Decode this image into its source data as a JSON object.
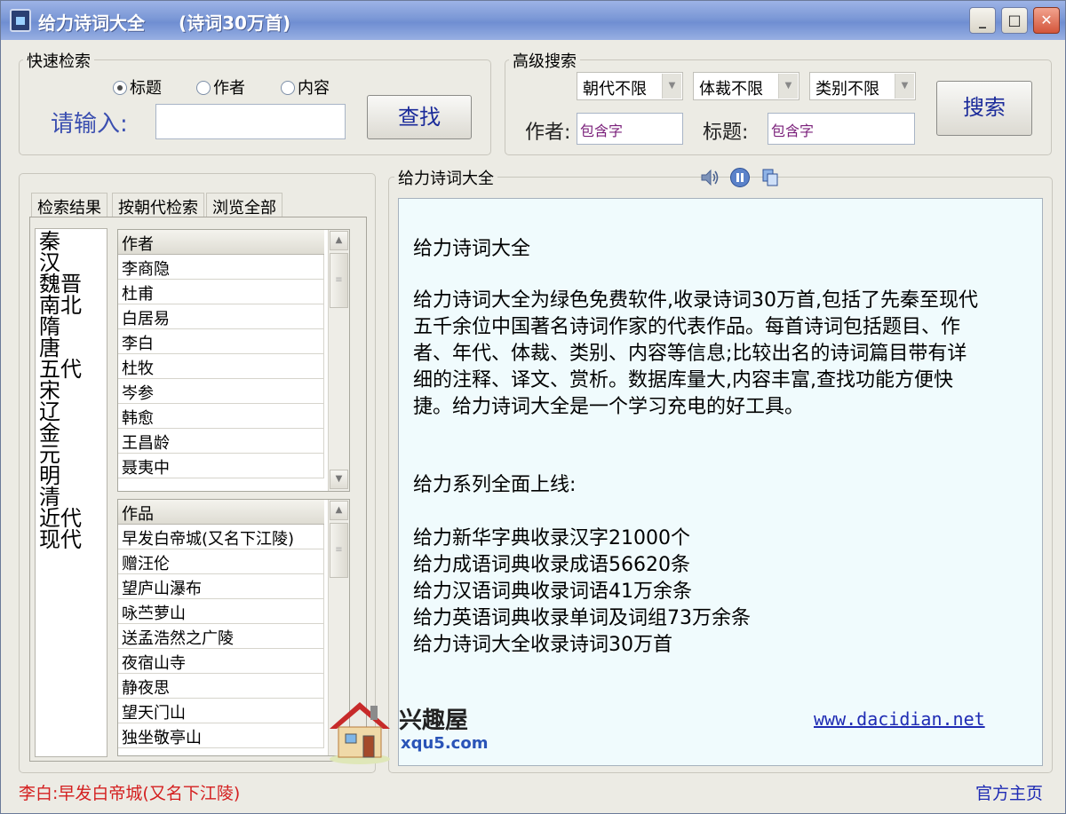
{
  "window": {
    "title": "给力诗词大全",
    "subtitle": "(诗词30万首)",
    "minimize_glyph": "_",
    "maximize_glyph": "□",
    "close_glyph": "✕"
  },
  "quick_search": {
    "group_title": "快速检索",
    "radios": [
      {
        "label": "标题",
        "checked": true
      },
      {
        "label": "作者",
        "checked": false
      },
      {
        "label": "内容",
        "checked": false
      }
    ],
    "input_label": "请输入:",
    "input_value": "",
    "button_label": "查找"
  },
  "advanced_search": {
    "group_title": "高级搜索",
    "dynasty_select": "朝代不限",
    "genre_select": "体裁不限",
    "category_select": "类别不限",
    "author_label": "作者:",
    "author_value": "包含字",
    "title_label": "标题:",
    "title_value": "包含字",
    "button_label": "搜索"
  },
  "left_panel": {
    "tabs": [
      "检索结果",
      "按朝代检索",
      "浏览全部"
    ],
    "dynasties": [
      "秦",
      "汉",
      "魏晋",
      "南北",
      "隋",
      "唐",
      "五代",
      "宋",
      "辽",
      "金",
      "元",
      "明",
      "清",
      "近代",
      "现代"
    ],
    "authors_header": "作者",
    "authors": [
      "李商隐",
      "杜甫",
      "白居易",
      "李白",
      "杜牧",
      "岑参",
      "韩愈",
      "王昌龄",
      "聂夷中"
    ],
    "works_header": "作品",
    "works": [
      "早发白帝城(又名下江陵)",
      "赠汪伦",
      "望庐山瀑布",
      "咏苎萝山",
      "送孟浩然之广陵",
      "夜宿山寺",
      "静夜思",
      "望天门山",
      "独坐敬亭山"
    ]
  },
  "right_panel": {
    "group_title": "给力诗词大全",
    "content": {
      "heading": "给力诗词大全",
      "paragraph_lines": [
        "给力诗词大全为绿色免费软件,收录诗词30万首,包括了先秦至现代",
        "五千余位中国著名诗词作家的代表作品。每首诗词包括题目、作",
        "者、年代、体裁、类别、内容等信息;比较出名的诗词篇目带有详",
        "细的注释、译文、赏析。数据库量大,内容丰富,查找功能方便快",
        "捷。给力诗词大全是一个学习充电的好工具。"
      ],
      "series_heading": "给力系列全面上线:",
      "series_items": [
        "给力新华字典收录汉字21000个",
        "给力成语词典收录成语56620条",
        "给力汉语词典收录词语41万余条",
        "给力英语词典收录单词及词组73万余条",
        "给力诗词大全收录诗词30万首"
      ],
      "link": "www.dacidian.net"
    }
  },
  "watermark": {
    "brand": "兴趣屋",
    "domain": "xqu5.com"
  },
  "status_bar": {
    "current": "李白:早发白帝城(又名下江陵)",
    "homepage": "官方主页"
  },
  "colors": {
    "accent_blue": "#1e2bb4",
    "status_red": "#d42020",
    "content_bg": "#f0fbfd"
  }
}
